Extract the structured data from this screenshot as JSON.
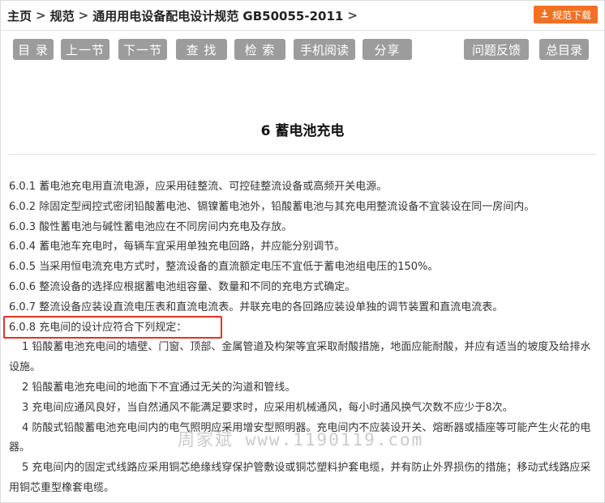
{
  "breadcrumb": {
    "home": "主页",
    "category": "规范",
    "current": "通用用电设备配电设计规范 GB50055-2011",
    "separator": ">"
  },
  "download": {
    "label": "规范下载",
    "icon": "download-icon"
  },
  "toolbar": {
    "toc": "目 录",
    "prev": "上一节",
    "next": "下一节",
    "find": "查 找",
    "search": "检 索",
    "mobile": "手机阅读",
    "share": "分享",
    "feedback": "问题反馈",
    "index": "总目录"
  },
  "section": {
    "title": "6 蓄电池充电",
    "items": [
      "6.0.1 蓄电池充电用直流电源，应采用硅整流、可控硅整流设备或高频开关电源。",
      "6.0.2 除固定型阀控式密闭铅酸蓄电池、镉镍蓄电池外，铅酸蓄电池与其充电用整流设备不宜装设在同一房间内。",
      "6.0.3 酸性蓄电池与碱性蓄电池应在不同房间内充电及存放。",
      "6.0.4 蓄电池车充电时，每辆车宜采用单独充电回路，并应能分别调节。",
      "6.0.5 当采用恒电流充电方式时，整流设备的直流额定电压不宜低于蓄电池组电压的150%。",
      "6.0.6 整流设备的选择应根据蓄电池组容量、数量和不同的充电方式确定。",
      "6.0.7 整流设备应装设直流电压表和直流电流表。并联充电的各回路应装设单独的调节装置和直流电流表。",
      "6.0.8 充电间的设计应符合下列规定："
    ],
    "subitems": [
      "1 铅酸蓄电池充电间的墙壁、门窗、顶部、金属管道及构架等宜采取耐酸措施，地面应能耐酸，并应有适当的坡度及给排水设施。",
      "2 铅酸蓄电池充电间的地面下不宜通过无关的沟道和管线。",
      "3 充电间应通风良好，当自然通风不能满足要求时，应采用机械通风，每小时通风换气次数不应少于8次。",
      "4 防酸式铅酸蓄电池充电间内的电气照明应采用增安型照明器。充电间内不应装设开关、熔断器或插座等可能产生火花的电器。",
      "5 充电间内的固定式线路应采用铜芯绝缘线穿保护管敷设或铜芯塑料护套电缆，并有防止外界损伤的措施；移动式线路应采用铜芯重型橡套电缆。"
    ]
  },
  "watermark": "周家斌 www.1190119.com",
  "colors": {
    "accent": "#f27022",
    "button": "#9c9c9c",
    "highlight": "#e0322b"
  }
}
